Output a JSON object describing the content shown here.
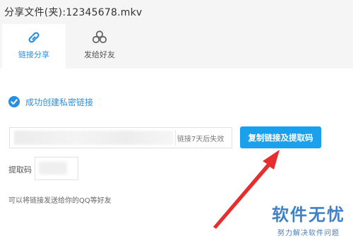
{
  "window": {
    "title": "分享文件(夹):12345678.mkv"
  },
  "tabs": [
    {
      "label": "链接分享",
      "icon": "link-icon",
      "active": true
    },
    {
      "label": "发给好友",
      "icon": "friends-icon",
      "active": false
    }
  ],
  "status": {
    "icon": "check-circle-icon",
    "text": "成功创建私密链接"
  },
  "link_field": {
    "value": "",
    "expire_text": "链接7天后失效"
  },
  "copy_button": {
    "label": "复制链接及提取码"
  },
  "code_field": {
    "label": "提取码",
    "value": ""
  },
  "hint": "可以将链接发送给你的QQ等好友",
  "watermark": {
    "title": "软件无忧",
    "subtitle": "努力解决软件问题"
  },
  "colors": {
    "accent": "#2b8fe0",
    "button": "#1aa0ec",
    "arrow": "#e62e2e",
    "watermark": "#3f81c8"
  }
}
